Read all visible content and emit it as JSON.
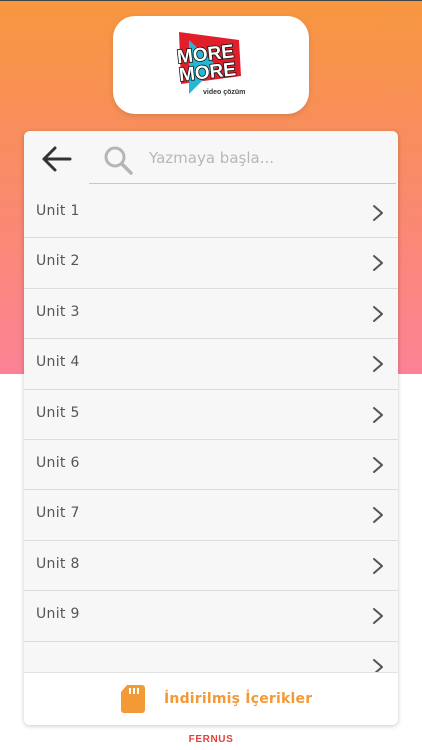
{
  "header": {
    "logo": {
      "line1": "MORE",
      "line2": "MORE",
      "tagline": "video çözüm",
      "icon": "more-and-more-logo"
    }
  },
  "search": {
    "placeholder": "Yazmaya başla...",
    "value": "",
    "icon": "search-icon",
    "back_icon": "arrow-left-icon"
  },
  "units": [
    {
      "label": "Unit 1"
    },
    {
      "label": "Unit 2"
    },
    {
      "label": "Unit 3"
    },
    {
      "label": "Unit 4"
    },
    {
      "label": "Unit 5"
    },
    {
      "label": "Unit 6"
    },
    {
      "label": "Unit 7"
    },
    {
      "label": "Unit 8"
    },
    {
      "label": "Unit 9"
    },
    {
      "label": ""
    }
  ],
  "footer": {
    "downloads_label": "İndirilmiş İçerikler",
    "icon": "sd-card-icon"
  },
  "brand": "FERNUS",
  "colors": {
    "gradient_top": "#f7973e",
    "gradient_bottom": "#fb8296",
    "accent": "#f39a36",
    "brand_red": "#e0423a"
  }
}
